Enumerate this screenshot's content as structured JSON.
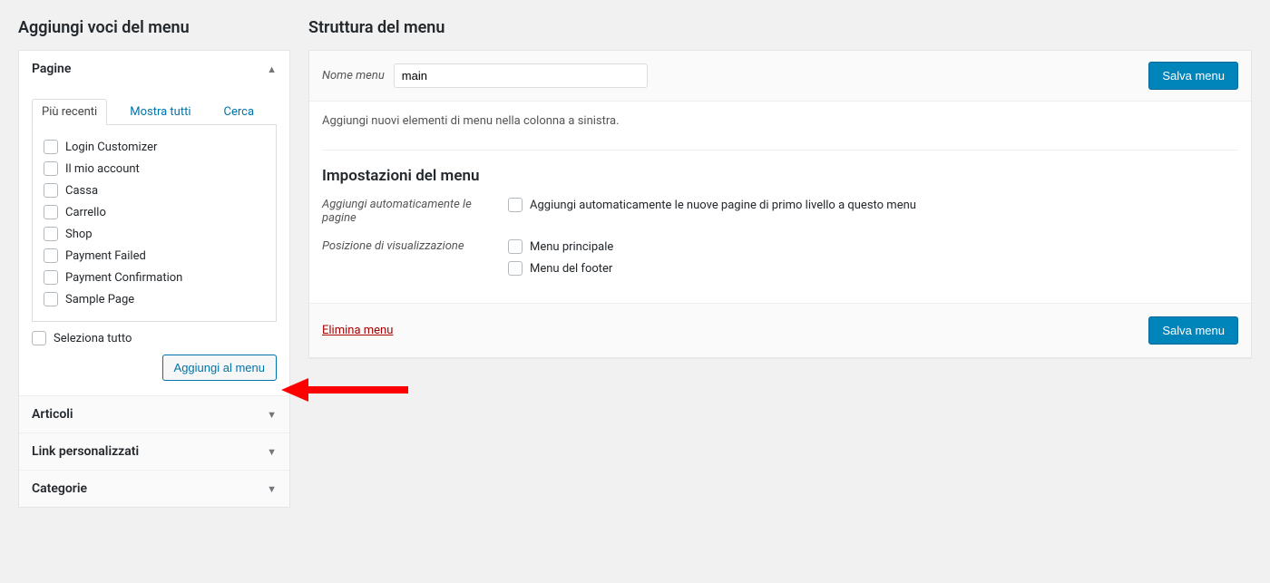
{
  "left": {
    "heading": "Aggiungi voci del menu",
    "sections": {
      "pagine": "Pagine",
      "articoli": "Articoli",
      "link": "Link personalizzati",
      "categorie": "Categorie"
    },
    "tabs": {
      "recent": "Più recenti",
      "all": "Mostra tutti",
      "search": "Cerca"
    },
    "pages": [
      "Login Customizer",
      "Il mio account",
      "Cassa",
      "Carrello",
      "Shop",
      "Payment Failed",
      "Payment Confirmation",
      "Sample Page"
    ],
    "select_all": "Seleziona tutto",
    "add_button": "Aggiungi al menu"
  },
  "right": {
    "heading": "Struttura del menu",
    "name_label": "Nome menu",
    "name_value": "main",
    "save_button": "Salva menu",
    "help": "Aggiungi nuovi elementi di menu nella colonna a sinistra.",
    "settings_heading": "Impostazioni del menu",
    "auto_add_label": "Aggiungi automaticamente le pagine",
    "auto_add_option": "Aggiungi automaticamente le nuove pagine di primo livello a questo menu",
    "position_label": "Posizione di visualizzazione",
    "position_main": "Menu principale",
    "position_footer": "Menu del footer",
    "delete": "Elimina menu"
  }
}
